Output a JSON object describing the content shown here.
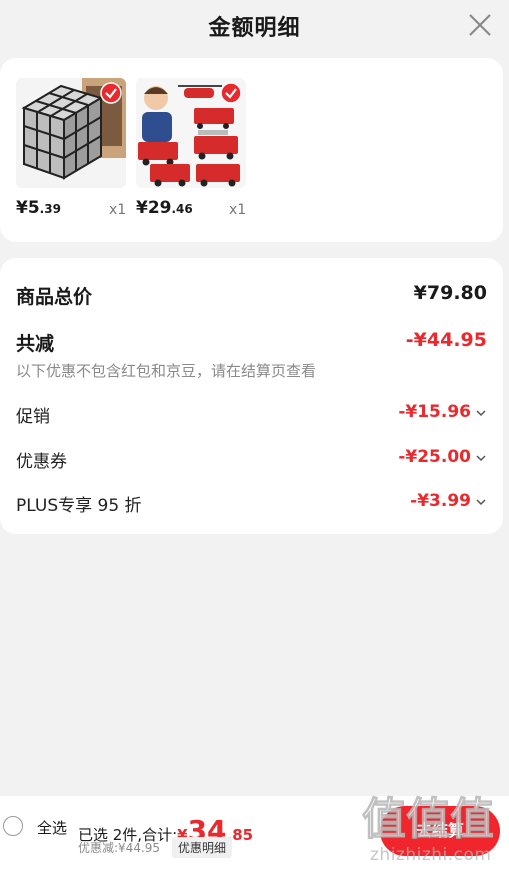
{
  "header": {
    "title": "金额明细",
    "close_icon": "close-icon"
  },
  "products": [
    {
      "price_int": "¥5",
      "price_dec": ".39",
      "qty": "x1",
      "image": "rubiks-cube-image",
      "checked": true
    },
    {
      "price_int": "¥29",
      "price_dec": ".46",
      "qty": "x1",
      "image": "fire-truck-toy-image",
      "checked": true
    }
  ],
  "summary": {
    "total_label": "商品总价",
    "total_value": "¥79.80",
    "reduce_label": "共减",
    "reduce_value": "-¥44.95",
    "note": "以下优惠不包含红包和京豆，请在结算页查看",
    "items": [
      {
        "label": "促销",
        "value": "-¥15.96"
      },
      {
        "label": "优惠券",
        "value": "-¥25.00"
      },
      {
        "label": "PLUS专享 95 折",
        "value": "-¥3.99"
      }
    ]
  },
  "bottom": {
    "select_all": "全选",
    "selected_prefix": "已选 2件,合计:",
    "total_yen": "¥",
    "total_int": "34",
    "total_dec": ".85",
    "discount_note": "优惠减:¥44.95",
    "detail_tag": "优惠明细",
    "settle_label": "去结算"
  },
  "watermark": {
    "text": "zhizhizhi.com",
    "logo": "值值值"
  },
  "colors": {
    "accent": "#e8292e",
    "background": "#f2f2f2",
    "card": "#ffffff"
  }
}
